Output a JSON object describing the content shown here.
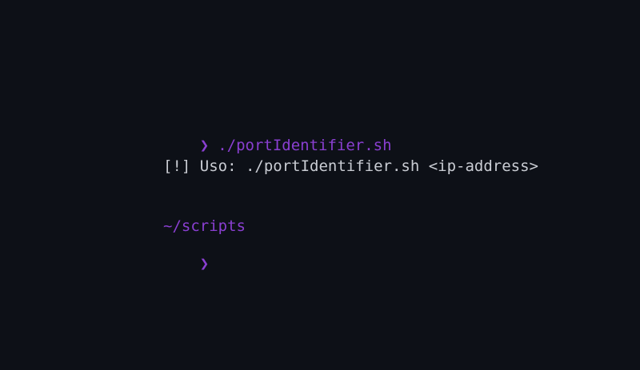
{
  "colors": {
    "background": "#0d1017",
    "accent": "#8a3fd1",
    "text": "#c9ccd3"
  },
  "terminal": {
    "prompt_symbol": "❯",
    "command": "./portIdentifier.sh",
    "output": "[!] Uso: ./portIdentifier.sh <ip-address>",
    "cwd": "~/scripts",
    "next_prompt_symbol": "❯"
  }
}
